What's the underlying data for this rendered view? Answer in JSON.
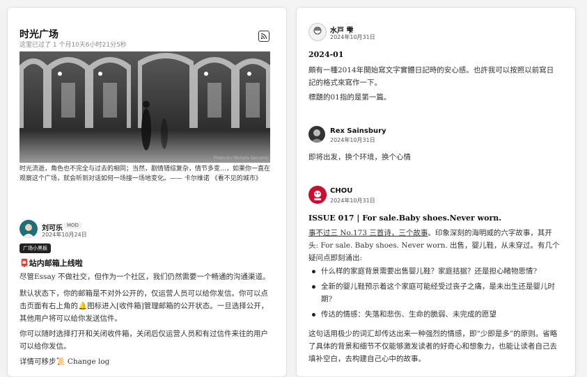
{
  "square": {
    "title": "时光广场",
    "subtitle": "这里已过了 1 个月10天6小时21分5秒",
    "photo_credit": "Photo by Michela Serventi",
    "quote": "时光流逝，角色也不完全与过去的相同；当然，剧情错综复杂，情节多变…，如果你一直在观察这个广场，就会听到对话如何一场接一场地变化。—— 卡尔维诺 《看不见的城市》"
  },
  "left_post": {
    "author": "刘可乐",
    "badge": "MOD",
    "date": "2024年10月24日",
    "tag": "广场小黑板",
    "title_icon": "📮",
    "title": "站内邮箱上线啦",
    "paragraphs": [
      "尽管Essay 不做社交，但作为一个社区，我们仍然需要一个畅通的沟通渠道。",
      "默认状态下，你的邮箱是不对外公开的，仅运营人员可以给你发信。你可以点击页面有右上角的🔔图标进入[收件箱]管理邮箱的公开状态。一旦选择公开，其他用户将可以给你发送信件。",
      "你可以随时选择打开和关闭收件箱，关闭后仅运营人员和有过信件来往的用户可以给你发信。",
      "详情可移步📜 Change log"
    ]
  },
  "right_posts": [
    {
      "author": "水戸 雫",
      "date": "2024年10月31日",
      "title": "2024-01",
      "paragraphs": [
        "頗有一種2014年開始寫文字實體日記時的安心感。也許我可以按照以前寫日記的格式來寫作一下。",
        "標題的01指的是第一篇。"
      ]
    },
    {
      "author": "Rex Sainsbury",
      "date": "2024年10月31日",
      "paragraphs": [
        "即将出发，换个环境，换个心情"
      ]
    },
    {
      "author": "CHOU",
      "date": "2024年10月31日",
      "title": "ISSUE 017 | For sale.Baby shoes.Never worn.",
      "intro_link": "事不过三 No.173 三首诗，三个故事",
      "intro_rest": "。印象深刻的海明威的六字故事，其开头: For sale. Baby shoes. Never worn. 出售，婴儿鞋，从未穿过。有几个疑问点即刻涌出:",
      "bullets": [
        "什么样的家庭背景需要出售婴儿鞋？家庭拮据？还是担心睹物思情?",
        "全新的婴儿鞋预示着这个家庭可能经受过丧子之痛，是未出生还是婴儿时期?",
        "传达的情感：失落和悲伤、生命的脆弱、未完成的愿望"
      ],
      "closing": "这句话用极少的词汇却传达出来一种强烈的情感，即“少即是多”的原则。省略了具体的背景和细节不仅能够激发读者的好奇心和想象力，也能让读者自己去填补空白，去构建自己心中的故事。"
    }
  ],
  "colors": {
    "card_bg": "#ffffff",
    "page_bg": "#f3f3f3",
    "tag_bg": "#222222",
    "chou_avatar": "#c8102e"
  }
}
